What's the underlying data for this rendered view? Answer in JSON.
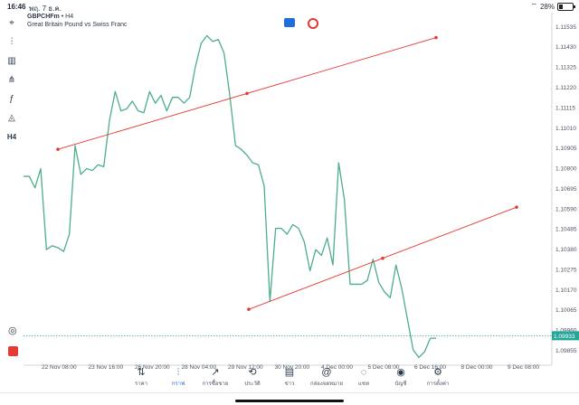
{
  "status": {
    "time": "16:46",
    "date": "พฤ. 7 ธ.ค.",
    "battery": "28%",
    "battery_level": 0.28
  },
  "symbol": {
    "name": "GBPCHFm",
    "timeframe": "H4",
    "description": "Great Britain Pound vs Swiss Franc"
  },
  "toolbar": [
    {
      "name": "crosshair-icon",
      "glyph": "⌖"
    },
    {
      "name": "chart-type-icon",
      "glyph": "⫶"
    },
    {
      "name": "objects-icon",
      "glyph": "▥"
    },
    {
      "name": "indicators-list-icon",
      "glyph": "⋔"
    },
    {
      "name": "function-icon",
      "glyph": "ƒ"
    },
    {
      "name": "shapes-icon",
      "glyph": "◬"
    },
    {
      "name": "timeframe-button",
      "glyph": "H4"
    }
  ],
  "price_axis": {
    "labels": [
      "1.11535",
      "1.11430",
      "1.11325",
      "1.11220",
      "1.11115",
      "1.11010",
      "1.10905",
      "1.10800",
      "1.10695",
      "1.10590",
      "1.10485",
      "1.10380",
      "1.10275",
      "1.10170",
      "1.10065",
      "1.09960",
      "1.09855"
    ],
    "current_price": "1.09933"
  },
  "time_axis": {
    "labels": [
      "22 Nov 08:00",
      "23 Nov 16:00",
      "26 Nov 20:00",
      "28 Nov 04:00",
      "29 Nov 12:00",
      "30 Nov 20:00",
      "4 Dec 00:00",
      "5 Dec 08:00",
      "6 Dec 16:00",
      "8 Dec 00:00",
      "9 Dec 08:00"
    ]
  },
  "chart_data": {
    "type": "line",
    "ylim": [
      1.0978,
      1.116
    ],
    "series": [
      {
        "values": [
          1.1076,
          1.1076,
          1.107,
          1.108,
          1.1038,
          1.104,
          1.1039,
          1.1037,
          1.1046,
          1.1092,
          1.1077,
          1.108,
          1.1079,
          1.1082,
          1.1081,
          1.1105,
          1.112,
          1.111,
          1.1111,
          1.1115,
          1.111,
          1.1109,
          1.112,
          1.1114,
          1.1118,
          1.111,
          1.1117,
          1.1117,
          1.1114,
          1.1117,
          1.1133,
          1.1145,
          1.1149,
          1.1146,
          1.1147,
          1.114,
          1.1118,
          1.1092,
          1.109,
          1.1087,
          1.1083,
          1.1082,
          1.1071,
          1.1011,
          1.1049,
          1.1049,
          1.1046,
          1.1051,
          1.1049,
          1.1042,
          1.1027,
          1.1038,
          1.1035,
          1.1044,
          1.103,
          1.1083,
          1.1064,
          1.102,
          1.102,
          1.102,
          1.1022,
          1.1033,
          1.1021,
          1.1016,
          1.1013,
          1.103,
          1.1018,
          1.1002,
          1.0986,
          1.0982,
          1.0985,
          1.0992,
          1.0992
        ]
      }
    ],
    "trendlines": [
      {
        "color": "#e53935",
        "points": [
          [
            0.1,
            1.109
          ],
          [
            1.0,
            1.1148
          ]
        ]
      },
      {
        "color": "#e53935",
        "points": [
          [
            0.37,
            1.1007
          ],
          [
            1.0,
            1.106
          ]
        ]
      }
    ],
    "current_price_line": 1.09933
  },
  "bottom_nav": [
    {
      "name": "nav-quotes",
      "icon": "⇅",
      "label": "ราคา",
      "active": false
    },
    {
      "name": "nav-charts",
      "icon": "⫶",
      "label": "กราฟ",
      "active": true
    },
    {
      "name": "nav-trade",
      "icon": "↗",
      "label": "การซื้อขาย",
      "active": false
    },
    {
      "name": "nav-history",
      "icon": "⟲",
      "label": "ประวัติ",
      "active": false
    },
    {
      "name": "nav-news",
      "icon": "▤",
      "label": "ข่าว",
      "active": false
    },
    {
      "name": "nav-mailbox",
      "icon": "@",
      "label": "กล่องจดหมาย",
      "active": false
    },
    {
      "name": "nav-chat",
      "icon": "◌",
      "label": "แชท",
      "active": false
    },
    {
      "name": "nav-accounts",
      "icon": "◉",
      "label": "บัญชี",
      "active": false
    },
    {
      "name": "nav-settings",
      "icon": "⚙",
      "label": "การตั้งค่า",
      "active": false
    }
  ]
}
